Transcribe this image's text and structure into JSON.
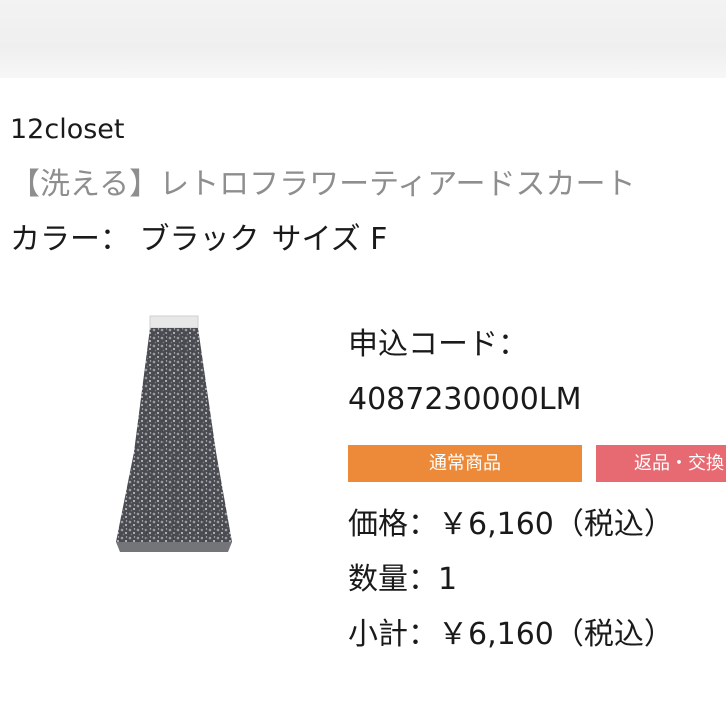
{
  "brand": "12closet",
  "product_name": "【洗える】レトロフラワーティアードスカート",
  "variant": {
    "color": "カラー： ブラック",
    "size": "サイズ F"
  },
  "order": {
    "code_label": "申込コード：",
    "code_value": "4087230000LM"
  },
  "badges": {
    "normal": "通常商品",
    "return": "返品・交換"
  },
  "price": "価格：￥6,160（税込）",
  "quantity": "数量：1",
  "subtotal": "小計：￥6,160（税込）",
  "icons": {
    "product_image": "long-tiered-floral-skirt"
  },
  "colors": {
    "badge_normal": "#ec8a3a",
    "badge_return": "#e76a72",
    "product_name_text": "#8e8e8e"
  }
}
